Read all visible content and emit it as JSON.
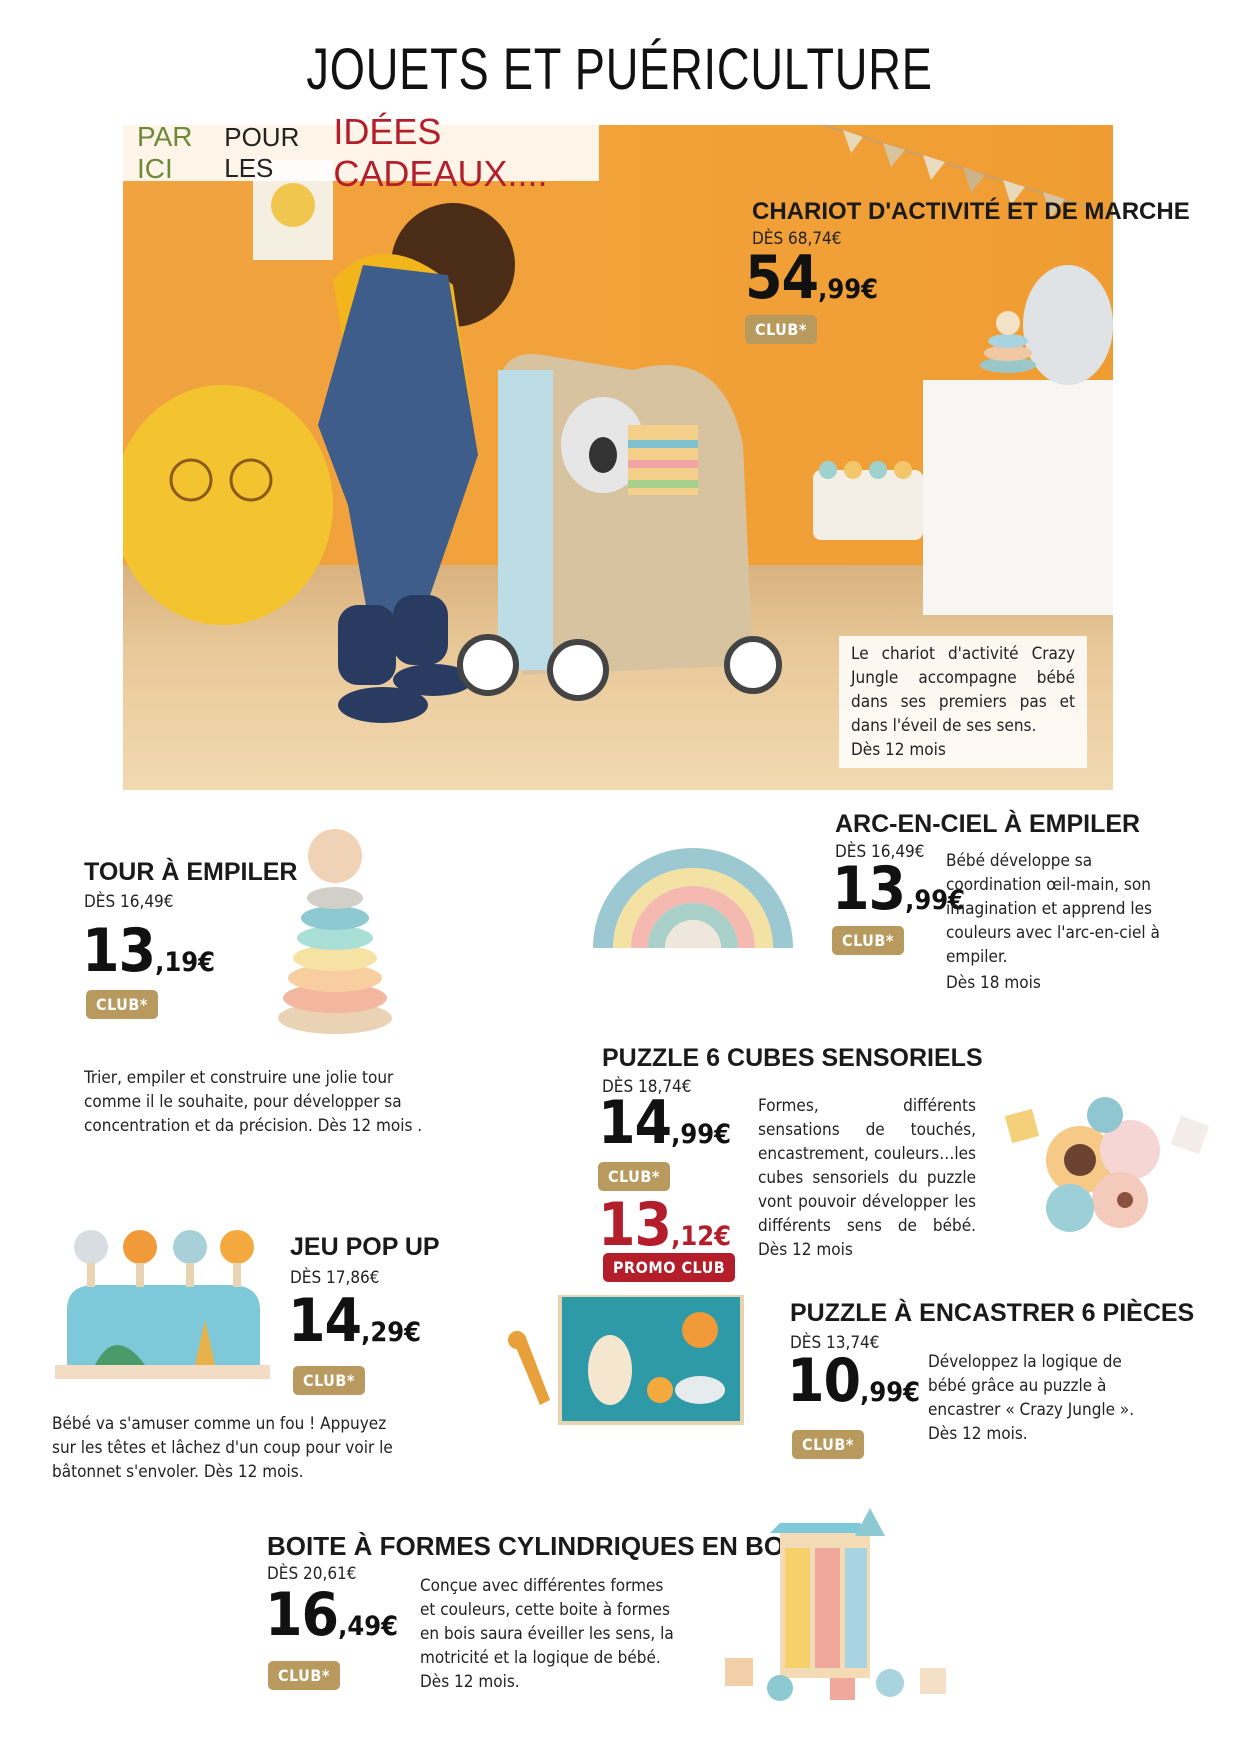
{
  "page": {
    "title": "JOUETS ET PUÉRICULTURE"
  },
  "hero": {
    "banner": {
      "part1": "PAR ICI",
      "part2": "POUR LES",
      "part3": "IDÉES CADEAUX...."
    },
    "product": {
      "name": "CHARIOT D'ACTIVITÉ ET DE MARCHE",
      "from": "DÈS 68,74€",
      "price_int": "54",
      "price_dec": ",99€",
      "badge": "CLUB*",
      "description": "Le chariot d'activité Crazy Jungle accompagne bébé dans ses premiers pas et dans l'éveil de ses sens.",
      "age": "Dès 12 mois"
    }
  },
  "products": {
    "tour": {
      "name": "TOUR À EMPILER",
      "from": "DÈS 16,49€",
      "price_int": "13",
      "price_dec": ",19€",
      "badge": "CLUB*",
      "description": "Trier, empiler et construire une jolie tour comme il le souhaite, pour développer sa concentration et da précision. Dès 12 mois ."
    },
    "arc": {
      "name": "ARC-EN-CIEL À EMPILER",
      "from": "DÈS 16,49€",
      "price_int": "13",
      "price_dec": ",99€",
      "badge": "CLUB*",
      "description": "Bébé développe sa coordination œil-main, son imagination et apprend les couleurs avec l'arc-en-ciel à empiler.",
      "age": "Dès 18 mois"
    },
    "puzzle_cubes": {
      "name": "PUZZLE 6 CUBES SENSORIELS",
      "from": "DÈS 18,74€",
      "price_int": "14",
      "price_dec": ",99€",
      "badge": "CLUB*",
      "promo_int": "13",
      "promo_dec": ",12€",
      "promo_badge": "PROMO CLUB",
      "description": "Formes, différents sensations de touchés, encastrement, couleurs…les cubes sensoriels du puzzle vont pouvoir développer les différents sens de bébé. Dès 12 mois"
    },
    "pop": {
      "name": "JEU POP UP",
      "from": "DÈS 17,86€",
      "price_int": "14",
      "price_dec": ",29€",
      "badge": "CLUB*",
      "description": "Bébé va s'amuser comme un fou ! Appuyez sur les têtes et lâchez d'un coup pour voir le bâtonnet s'envoler. Dès 12 mois."
    },
    "encastrer": {
      "name": "PUZZLE À ENCASTRER 6 PIÈCES",
      "from": "DÈS 13,74€",
      "price_int": "10",
      "price_dec": ",99€",
      "badge": "CLUB*",
      "description": "Développez la logique de bébé grâce au puzzle à encastrer « Crazy Jungle ». Dès 12 mois."
    },
    "boite": {
      "name": "BOITE À FORMES CYLINDRIQUES EN BOIS",
      "from": "DÈS 20,61€",
      "price_int": "16",
      "price_dec": ",49€",
      "badge": "CLUB*",
      "description": "Conçue avec différentes formes et couleurs, cette boite à formes en bois saura éveiller les sens, la motricité et la logique de bébé. Dès 12 mois."
    }
  },
  "colors": {
    "club": "#b89a5e",
    "promo": "#b31e2a",
    "banner_green": "#6d8a3a",
    "banner_red": "#b31e2a",
    "hero_orange": "#f0a33f"
  }
}
